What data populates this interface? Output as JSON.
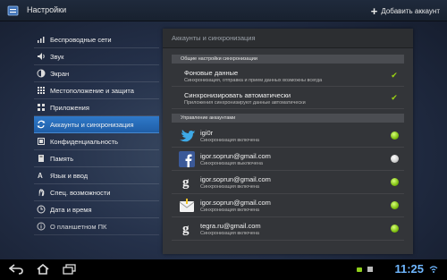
{
  "header": {
    "title": "Настройки",
    "add_account": "Добавить аккаунт"
  },
  "sidebar": {
    "items": [
      {
        "label": "Беспроводные сети",
        "icon": "wifi-icon"
      },
      {
        "label": "Звук",
        "icon": "sound-icon"
      },
      {
        "label": "Экран",
        "icon": "display-icon"
      },
      {
        "label": "Местоположение и защита",
        "icon": "location-icon"
      },
      {
        "label": "Приложения",
        "icon": "apps-icon"
      },
      {
        "label": "Аккаунты и синхронизация",
        "icon": "sync-icon",
        "active": true
      },
      {
        "label": "Конфиденциальность",
        "icon": "privacy-icon"
      },
      {
        "label": "Память",
        "icon": "storage-icon"
      },
      {
        "label": "Язык и ввод",
        "icon": "language-icon"
      },
      {
        "label": "Спец. возможности",
        "icon": "accessibility-icon"
      },
      {
        "label": "Дата и время",
        "icon": "clock-icon"
      },
      {
        "label": "О планшетном ПК",
        "icon": "info-icon"
      }
    ]
  },
  "panel": {
    "title": "Аккаунты и синхронизация",
    "general_header": "Общие настройки синхронизации",
    "general": [
      {
        "title": "Фоновые данные",
        "sub": "Синхронизация, отправка и прием данных возможны всегда",
        "checked": true
      },
      {
        "title": "Синхронизировать автоматически",
        "sub": "Приложения синхронизируют данные автоматически",
        "checked": true
      }
    ],
    "accounts_header": "Управление аккаунтами",
    "accounts": [
      {
        "name": "igi0r",
        "status": "Синхронизация включена",
        "service": "twitter-icon",
        "sync_on": true
      },
      {
        "name": "igor.soprun@gmail.com",
        "status": "Синхронизация выключена",
        "service": "facebook-icon",
        "sync_on": false
      },
      {
        "name": "igor.soprun@gmail.com",
        "status": "Синхронизация включена",
        "service": "google-icon",
        "sync_on": true
      },
      {
        "name": "igor.soprun@gmail.com",
        "status": "Синхронизация включена",
        "service": "email-icon",
        "sync_on": true
      },
      {
        "name": "tegra.ru@gmail.com",
        "status": "Синхронизация включена",
        "service": "google-icon",
        "sync_on": true
      }
    ]
  },
  "status_bar": {
    "time": "11:25"
  },
  "colors": {
    "accent": "#2f79c9",
    "sync_on": "#8fd01a",
    "clock": "#6fb7ff"
  }
}
